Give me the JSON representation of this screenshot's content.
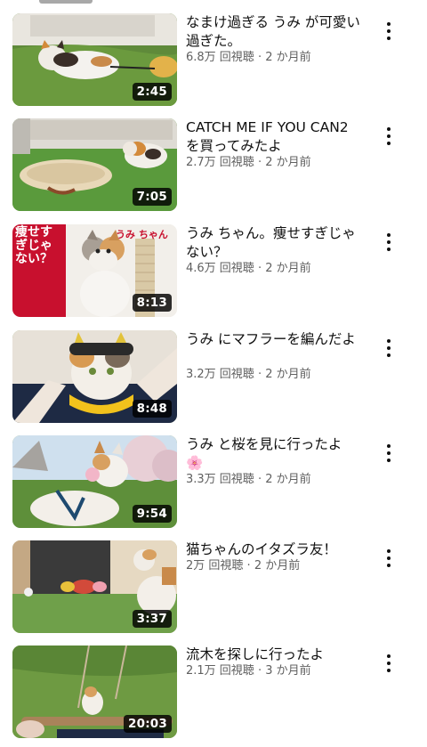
{
  "videos": [
    {
      "title": "なまけ過ぎる うみ が可愛い過ぎた。",
      "views": "6.8万 回視聴",
      "age": "2 か月前",
      "duration": "2:45"
    },
    {
      "title": "CATCH ME IF YOU CAN2を買ってみたよ",
      "views": "2.7万 回視聴",
      "age": "2 か月前",
      "duration": "7:05"
    },
    {
      "title": "うみ ちゃん。痩せすぎじゃない？",
      "views": "4.6万 回視聴",
      "age": "2 か月前",
      "duration": "8:13"
    },
    {
      "title": "うみ にマフラーを編んだよ",
      "views": "3.2万 回視聴",
      "age": "2 か月前",
      "duration": "8:48"
    },
    {
      "title": "うみ と桜を見に行ったよ 🌸",
      "views": "3.3万 回視聴",
      "age": "2 か月前",
      "duration": "9:54"
    },
    {
      "title": "猫ちゃんのイタズラ友！",
      "views": "2万 回視聴",
      "age": "2 か月前",
      "duration": "3:37"
    },
    {
      "title": "流木を探しに行ったよ",
      "views": "2.1万 回視聴",
      "age": "3 か月前",
      "duration": "20:03"
    }
  ],
  "thumb_overlays": {
    "umi_chan": "うみ ちゃん",
    "yase": "痩せすぎじゃない？"
  },
  "meta_separator": " · "
}
